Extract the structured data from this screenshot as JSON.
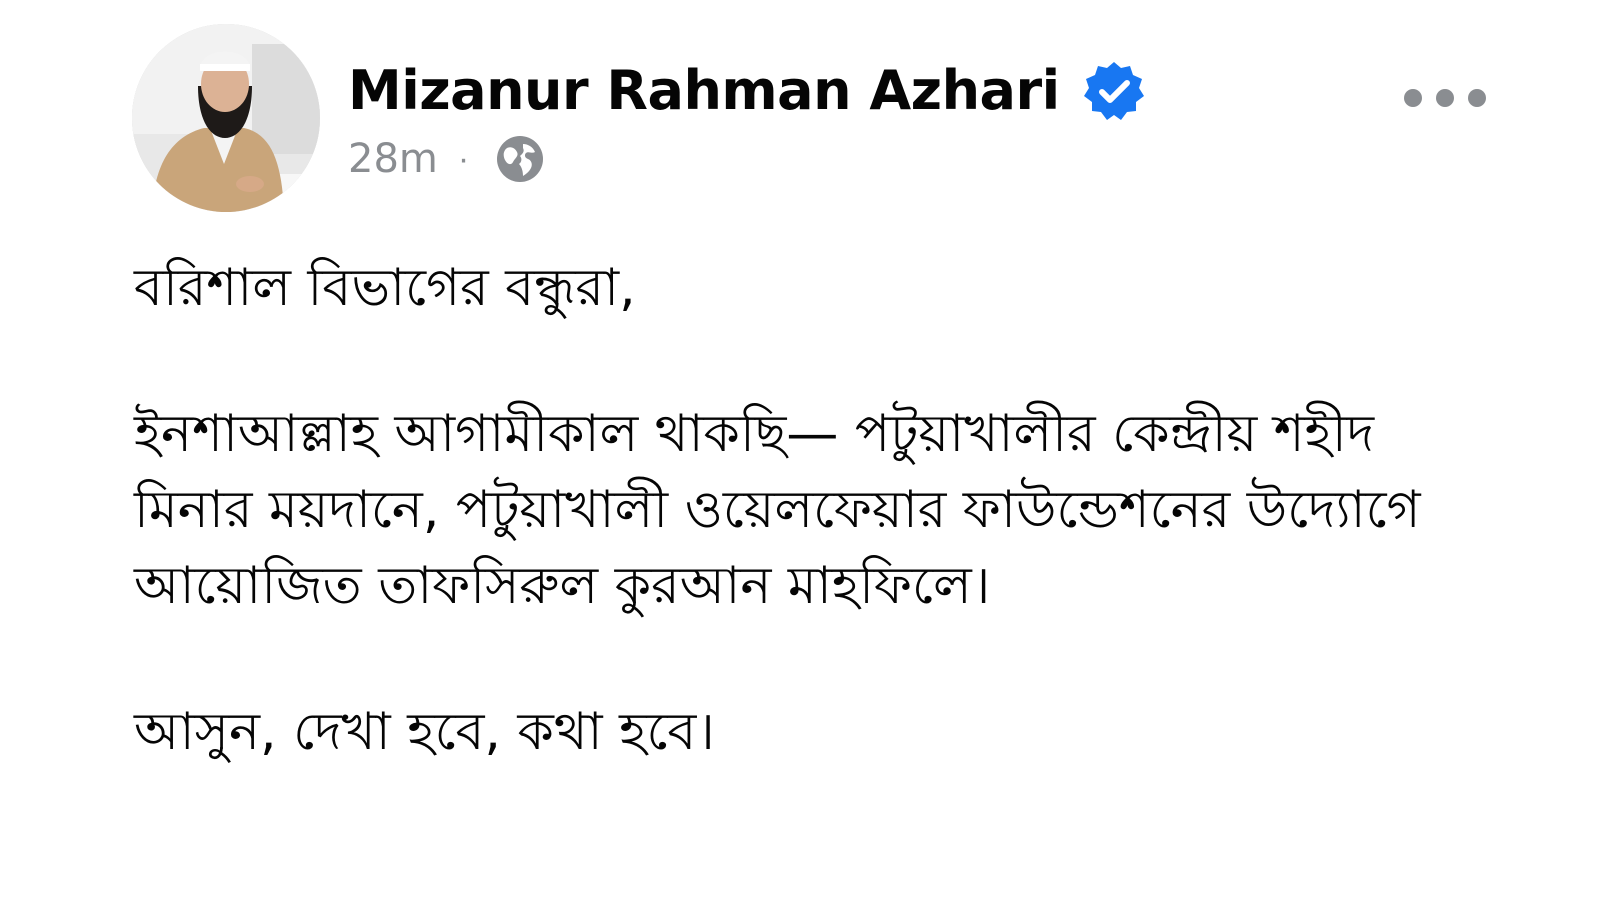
{
  "author": {
    "name": "Mizanur Rahman Azhari",
    "verified": true,
    "verified_color": "#1877f2"
  },
  "meta": {
    "timestamp": "28m",
    "separator": "·",
    "audience_icon": "globe-icon"
  },
  "menu": {
    "icon": "more-horizontal-icon"
  },
  "post": {
    "greeting": "বরিশাল বিভাগের বন্ধুরা,",
    "body": "ইনশাআল্লাহ আগামীকাল থাকছি— পটুয়াখালীর কেন্দ্রীয় শহীদ মিনার ময়দানে, পটুয়াখালী ওয়েলফেয়ার ফাউন্ডেশনের উদ্যোগে আয়োজিত তাফসিরুল কুরআন মাহফিলে।",
    "closing": "আসুন, দেখা হবে, কথা হবে।"
  },
  "colors": {
    "text": "#050505",
    "secondary_text": "#8a8d91",
    "background": "#ffffff"
  }
}
